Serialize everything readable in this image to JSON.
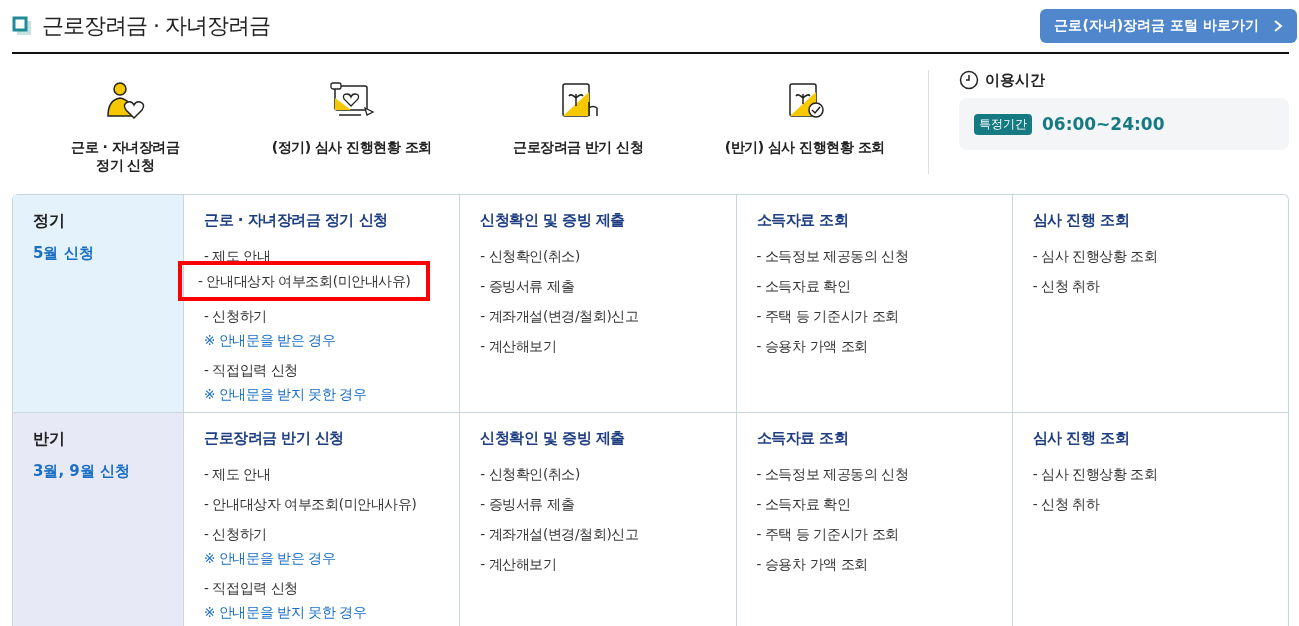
{
  "header": {
    "title": "근로장려금 · 자녀장려금",
    "portal_button": "근로(자녀)장려금 포털 바로가기"
  },
  "shortcuts": [
    {
      "kind": "person",
      "label": "근로 · 자녀장려금\n정기 신청"
    },
    {
      "kind": "screen",
      "label": "(정기) 심사 진행현황 조회"
    },
    {
      "kind": "pointer",
      "label": "근로장려금 반기 신청"
    },
    {
      "kind": "check",
      "label": "(반기) 심사 진행현황 조회"
    }
  ],
  "hours": {
    "title": "이용시간",
    "badge": "특정기간",
    "time": "06:00~24:00"
  },
  "rows": [
    {
      "title": "정기",
      "subtitle": "5월 신청",
      "color": "#e3f2fb",
      "columns": [
        {
          "title": "근로 · 자녀장려금 정기 신청",
          "items": [
            {
              "kind": "link",
              "text": "- 제도 안내",
              "highlighted": false
            },
            {
              "kind": "link",
              "text": "- 안내대상자 여부조회(미안내사유)",
              "highlighted": true
            },
            {
              "kind": "link",
              "text": "- 신청하기",
              "highlighted": false
            },
            {
              "kind": "note",
              "text": "※ 안내문을 받은 경우",
              "highlighted": false
            },
            {
              "kind": "link",
              "text": "- 직접입력 신청",
              "highlighted": false
            },
            {
              "kind": "note",
              "text": "※ 안내문을 받지 못한 경우",
              "highlighted": false
            }
          ]
        },
        {
          "title": "신청확인 및 증빙 제출",
          "items": [
            {
              "kind": "link",
              "text": "- 신청확인(취소)",
              "highlighted": false
            },
            {
              "kind": "link",
              "text": "- 증빙서류 제출",
              "highlighted": false
            },
            {
              "kind": "link",
              "text": "- 계좌개설(변경/철회)신고",
              "highlighted": false
            },
            {
              "kind": "link",
              "text": "- 계산해보기",
              "highlighted": false
            }
          ]
        },
        {
          "title": "소득자료 조회",
          "items": [
            {
              "kind": "link",
              "text": "- 소득정보 제공동의 신청",
              "highlighted": false
            },
            {
              "kind": "link",
              "text": "- 소득자료 확인",
              "highlighted": false
            },
            {
              "kind": "link",
              "text": "- 주택 등 기준시가 조회",
              "highlighted": false
            },
            {
              "kind": "link",
              "text": "- 승용차 가액 조회",
              "highlighted": false
            }
          ]
        },
        {
          "title": "심사 진행 조회",
          "items": [
            {
              "kind": "link",
              "text": "- 심사 진행상황 조회",
              "highlighted": false
            },
            {
              "kind": "link",
              "text": "- 신청 취하",
              "highlighted": false
            }
          ]
        }
      ]
    },
    {
      "title": "반기",
      "subtitle": "3월, 9월 신청",
      "color": "#e7e9f6",
      "columns": [
        {
          "title": "근로장려금 반기 신청",
          "items": [
            {
              "kind": "link",
              "text": "- 제도 안내",
              "highlighted": false
            },
            {
              "kind": "link",
              "text": "- 안내대상자 여부조회(미안내사유)",
              "highlighted": false
            },
            {
              "kind": "link",
              "text": "- 신청하기",
              "highlighted": false
            },
            {
              "kind": "note",
              "text": "※ 안내문을 받은 경우",
              "highlighted": false
            },
            {
              "kind": "link",
              "text": "- 직접입력 신청",
              "highlighted": false
            },
            {
              "kind": "note",
              "text": "※ 안내문을 받지 못한 경우",
              "highlighted": false
            }
          ]
        },
        {
          "title": "신청확인 및 증빙 제출",
          "items": [
            {
              "kind": "link",
              "text": "- 신청확인(취소)",
              "highlighted": false
            },
            {
              "kind": "link",
              "text": "- 증빙서류 제출",
              "highlighted": false
            },
            {
              "kind": "link",
              "text": "- 계좌개설(변경/철회)신고",
              "highlighted": false
            },
            {
              "kind": "link",
              "text": "- 계산해보기",
              "highlighted": false
            }
          ]
        },
        {
          "title": "소득자료 조회",
          "items": [
            {
              "kind": "link",
              "text": "- 소득정보 제공동의 신청",
              "highlighted": false
            },
            {
              "kind": "link",
              "text": "- 소득자료 확인",
              "highlighted": false
            },
            {
              "kind": "link",
              "text": "- 주택 등 기준시가 조회",
              "highlighted": false
            },
            {
              "kind": "link",
              "text": "- 승용차 가액 조회",
              "highlighted": false
            }
          ]
        },
        {
          "title": "심사 진행 조회",
          "items": [
            {
              "kind": "link",
              "text": "- 심사 진행상황 조회",
              "highlighted": false
            },
            {
              "kind": "link",
              "text": "- 신청 취하",
              "highlighted": false
            }
          ]
        }
      ]
    }
  ]
}
